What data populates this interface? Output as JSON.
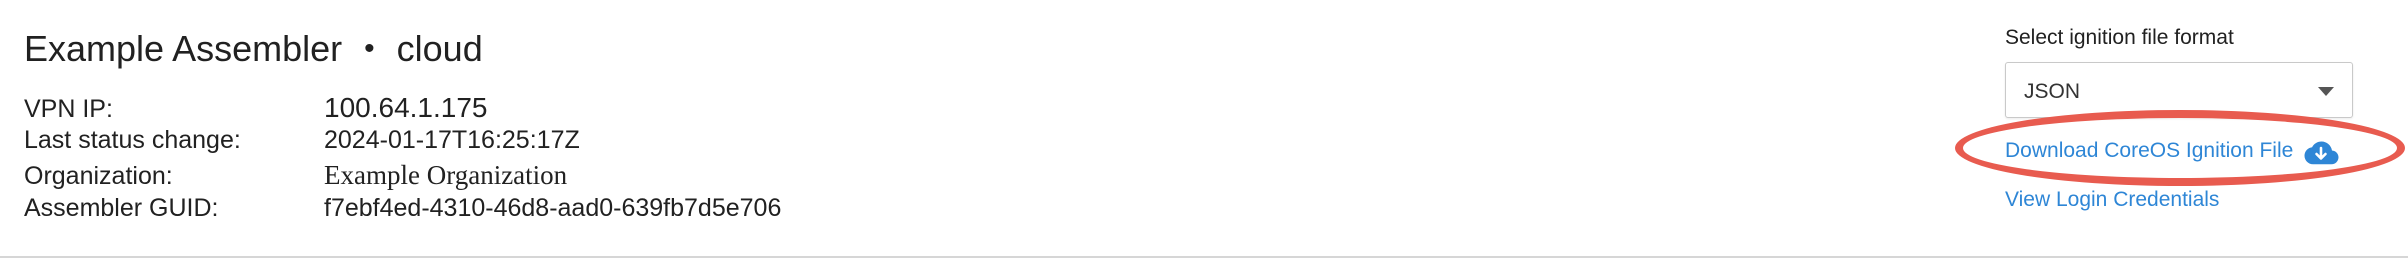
{
  "header": {
    "name": "Example Assembler",
    "separator": "•",
    "environment": "cloud"
  },
  "details": [
    {
      "label": "VPN IP:",
      "value": "100.64.1.175"
    },
    {
      "label": "Last status change:",
      "value": "2024-01-17T16:25:17Z"
    },
    {
      "label": "Organization:",
      "value": "Example Organization"
    },
    {
      "label": "Assembler GUID:",
      "value": "f7ebf4ed-4310-46d8-aad0-639fb7d5e706"
    }
  ],
  "ignition": {
    "select_label": "Select ignition file format",
    "selected_format": "JSON",
    "download_label": "Download CoreOS Ignition File",
    "download_icon": "cloud-download-icon",
    "view_credentials_label": "View Login Credentials"
  },
  "colors": {
    "link": "#2e86d6",
    "highlight_oval": "#e85b4f",
    "divider": "#d6d6d6"
  }
}
